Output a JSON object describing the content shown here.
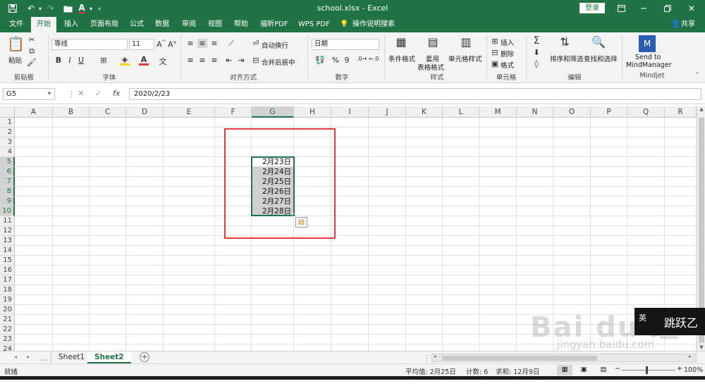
{
  "titlebar": {
    "title": "school.xlsx  -  Excel",
    "login": "登录",
    "undo_icon": "undo-icon",
    "redo_icon": "redo-icon",
    "save_icon": "save-icon"
  },
  "tabs": [
    "文件",
    "开始",
    "插入",
    "页面布局",
    "公式",
    "数据",
    "审阅",
    "视图",
    "帮助",
    "福昕PDF",
    "WPS PDF",
    "操作说明搜索"
  ],
  "share": "共享",
  "ribbon": {
    "clipboard": {
      "paste": "粘贴",
      "label": "剪贴板"
    },
    "font": {
      "name": "等线",
      "size": "11",
      "label": "字体",
      "bold": "B",
      "italic": "I",
      "underline": "U"
    },
    "alignment": {
      "wrap": "自动换行",
      "merge": "合并后居中",
      "label": "对齐方式"
    },
    "number": {
      "format": "日期",
      "percent": "%",
      "comma": "9",
      "label": "数字"
    },
    "styles": {
      "conditional": "条件格式",
      "table1": "套用",
      "table2": "表格格式",
      "cell": "单元格样式",
      "label": "样式"
    },
    "cells": {
      "insert": "插入",
      "delete": "删除",
      "format": "格式",
      "label": "单元格"
    },
    "editing": {
      "sort": "排序和筛选",
      "find": "查找和选择",
      "label": "编辑",
      "sum_symbol": "Σ"
    },
    "mindjet": {
      "send1": "Send to",
      "send2": "MindManager",
      "label": "Mindjet"
    }
  },
  "formula": {
    "namebox": "G5",
    "fx": "fx",
    "value": "2020/2/23"
  },
  "columns": [
    "A",
    "B",
    "C",
    "D",
    "E",
    "F",
    "G",
    "H",
    "I",
    "J",
    "K",
    "L",
    "M",
    "N",
    "O",
    "P",
    "Q",
    "R"
  ],
  "rows": [
    "1",
    "2",
    "3",
    "4",
    "5",
    "6",
    "7",
    "8",
    "9",
    "10",
    "11",
    "12",
    "13",
    "14",
    "15",
    "16",
    "17",
    "18",
    "19",
    "20",
    "21",
    "22",
    "23",
    "24"
  ],
  "cells": {
    "G5": "2月23日",
    "G6": "2月24日",
    "G7": "2月25日",
    "G8": "2月26日",
    "G9": "2月27日",
    "G10": "2月28日"
  },
  "sheets": [
    "Sheet1",
    "Sheet2"
  ],
  "active_sheet": "Sheet2",
  "status": {
    "ready": "就绪",
    "average": "平均值: 2月25日",
    "count": "计数: 6",
    "sum": "求和: 12月9日",
    "zoom": "100%"
  },
  "watermark": {
    "text": "Bai  du 经验",
    "url": "jingyan.baidu.com",
    "ime_label": "英",
    "stamp": "跳跃乙"
  },
  "colors": {
    "excel_green": "#217346",
    "highlight_red": "#e03c3c",
    "selection_fill": "#d0d0d0"
  }
}
